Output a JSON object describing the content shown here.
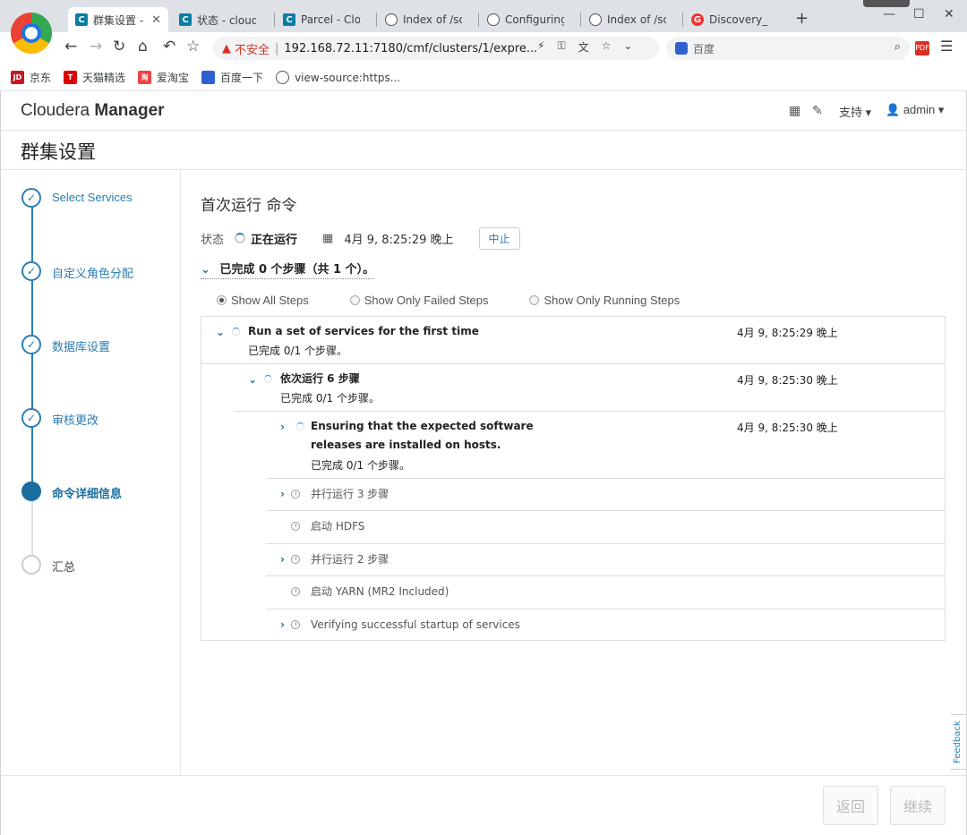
{
  "browser": {
    "tabs": [
      {
        "title": "群集设置 -",
        "icon": "c"
      },
      {
        "title": "状态 - clouder",
        "icon": "c"
      },
      {
        "title": "Parcel - Cloud",
        "icon": "c"
      },
      {
        "title": "Index of /softu",
        "icon": "g"
      },
      {
        "title": "Configuring a",
        "icon": "g"
      },
      {
        "title": "Index of /softu",
        "icon": "g"
      },
      {
        "title": "Discovery_We",
        "icon": "d"
      }
    ],
    "insecure_label": "不安全",
    "url": "192.168.72.11:7180/cmf/clusters/1/expre...",
    "search_placeholder": "百度",
    "bookmarks": [
      {
        "label": "京东",
        "icon_text": "JD",
        "color": "#c81623"
      },
      {
        "label": "天猫精选",
        "icon_text": "T",
        "color": "#d00"
      },
      {
        "label": "爱淘宝",
        "icon_text": "淘",
        "color": "#e44"
      },
      {
        "label": "百度一下",
        "icon_text": "",
        "color": "#3060d0"
      },
      {
        "label": "view-source:https...",
        "icon_text": "",
        "color": "#555"
      }
    ]
  },
  "header": {
    "brand_light": "Cloudera",
    "brand_bold": "Manager",
    "support": "支持",
    "user": "admin"
  },
  "page_title": "群集设置",
  "wizard_steps": [
    {
      "label": "Select Services",
      "state": "done"
    },
    {
      "label": "自定义角色分配",
      "state": "done"
    },
    {
      "label": "数据库设置",
      "state": "done"
    },
    {
      "label": "审核更改",
      "state": "done"
    },
    {
      "label": "命令详细信息",
      "state": "current"
    },
    {
      "label": "汇总",
      "state": "todo"
    }
  ],
  "command": {
    "title": "首次运行 命令",
    "status_label": "状态",
    "status_value": "正在运行",
    "timestamp": "4月 9, 8:25:29 晚上",
    "abort_label": "中止",
    "summary": "已完成 0 个步骤（共 1 个）。"
  },
  "filters": [
    {
      "label": "Show All Steps",
      "selected": true
    },
    {
      "label": "Show Only Failed Steps",
      "selected": false
    },
    {
      "label": "Show Only Running Steps",
      "selected": false
    }
  ],
  "steps": {
    "root": {
      "name": "Run a set of services for the first time",
      "progress": "已完成 0/1 个步骤。",
      "time": "4月 9, 8:25:29 晚上"
    },
    "seq": {
      "name": "依次运行 6 步骤",
      "progress": "已完成 0/1 个步骤。",
      "time": "4月 9, 8:25:30 晚上"
    },
    "ensure": {
      "name": "Ensuring that the expected software releases are installed on hosts.",
      "progress": "已完成 0/1 个步骤。",
      "time": "4月 9, 8:25:30 晚上"
    },
    "par3": {
      "name": "并行运行 3 步骤"
    },
    "hdfs": {
      "name": "启动 HDFS"
    },
    "par2": {
      "name": "并行运行 2 步骤"
    },
    "yarn": {
      "name": "启动 YARN (MR2 Included)"
    },
    "verify": {
      "name": "Verifying successful startup of services"
    }
  },
  "feedback_label": "Feedback",
  "footer": {
    "back": "返回",
    "continue": "继续"
  }
}
